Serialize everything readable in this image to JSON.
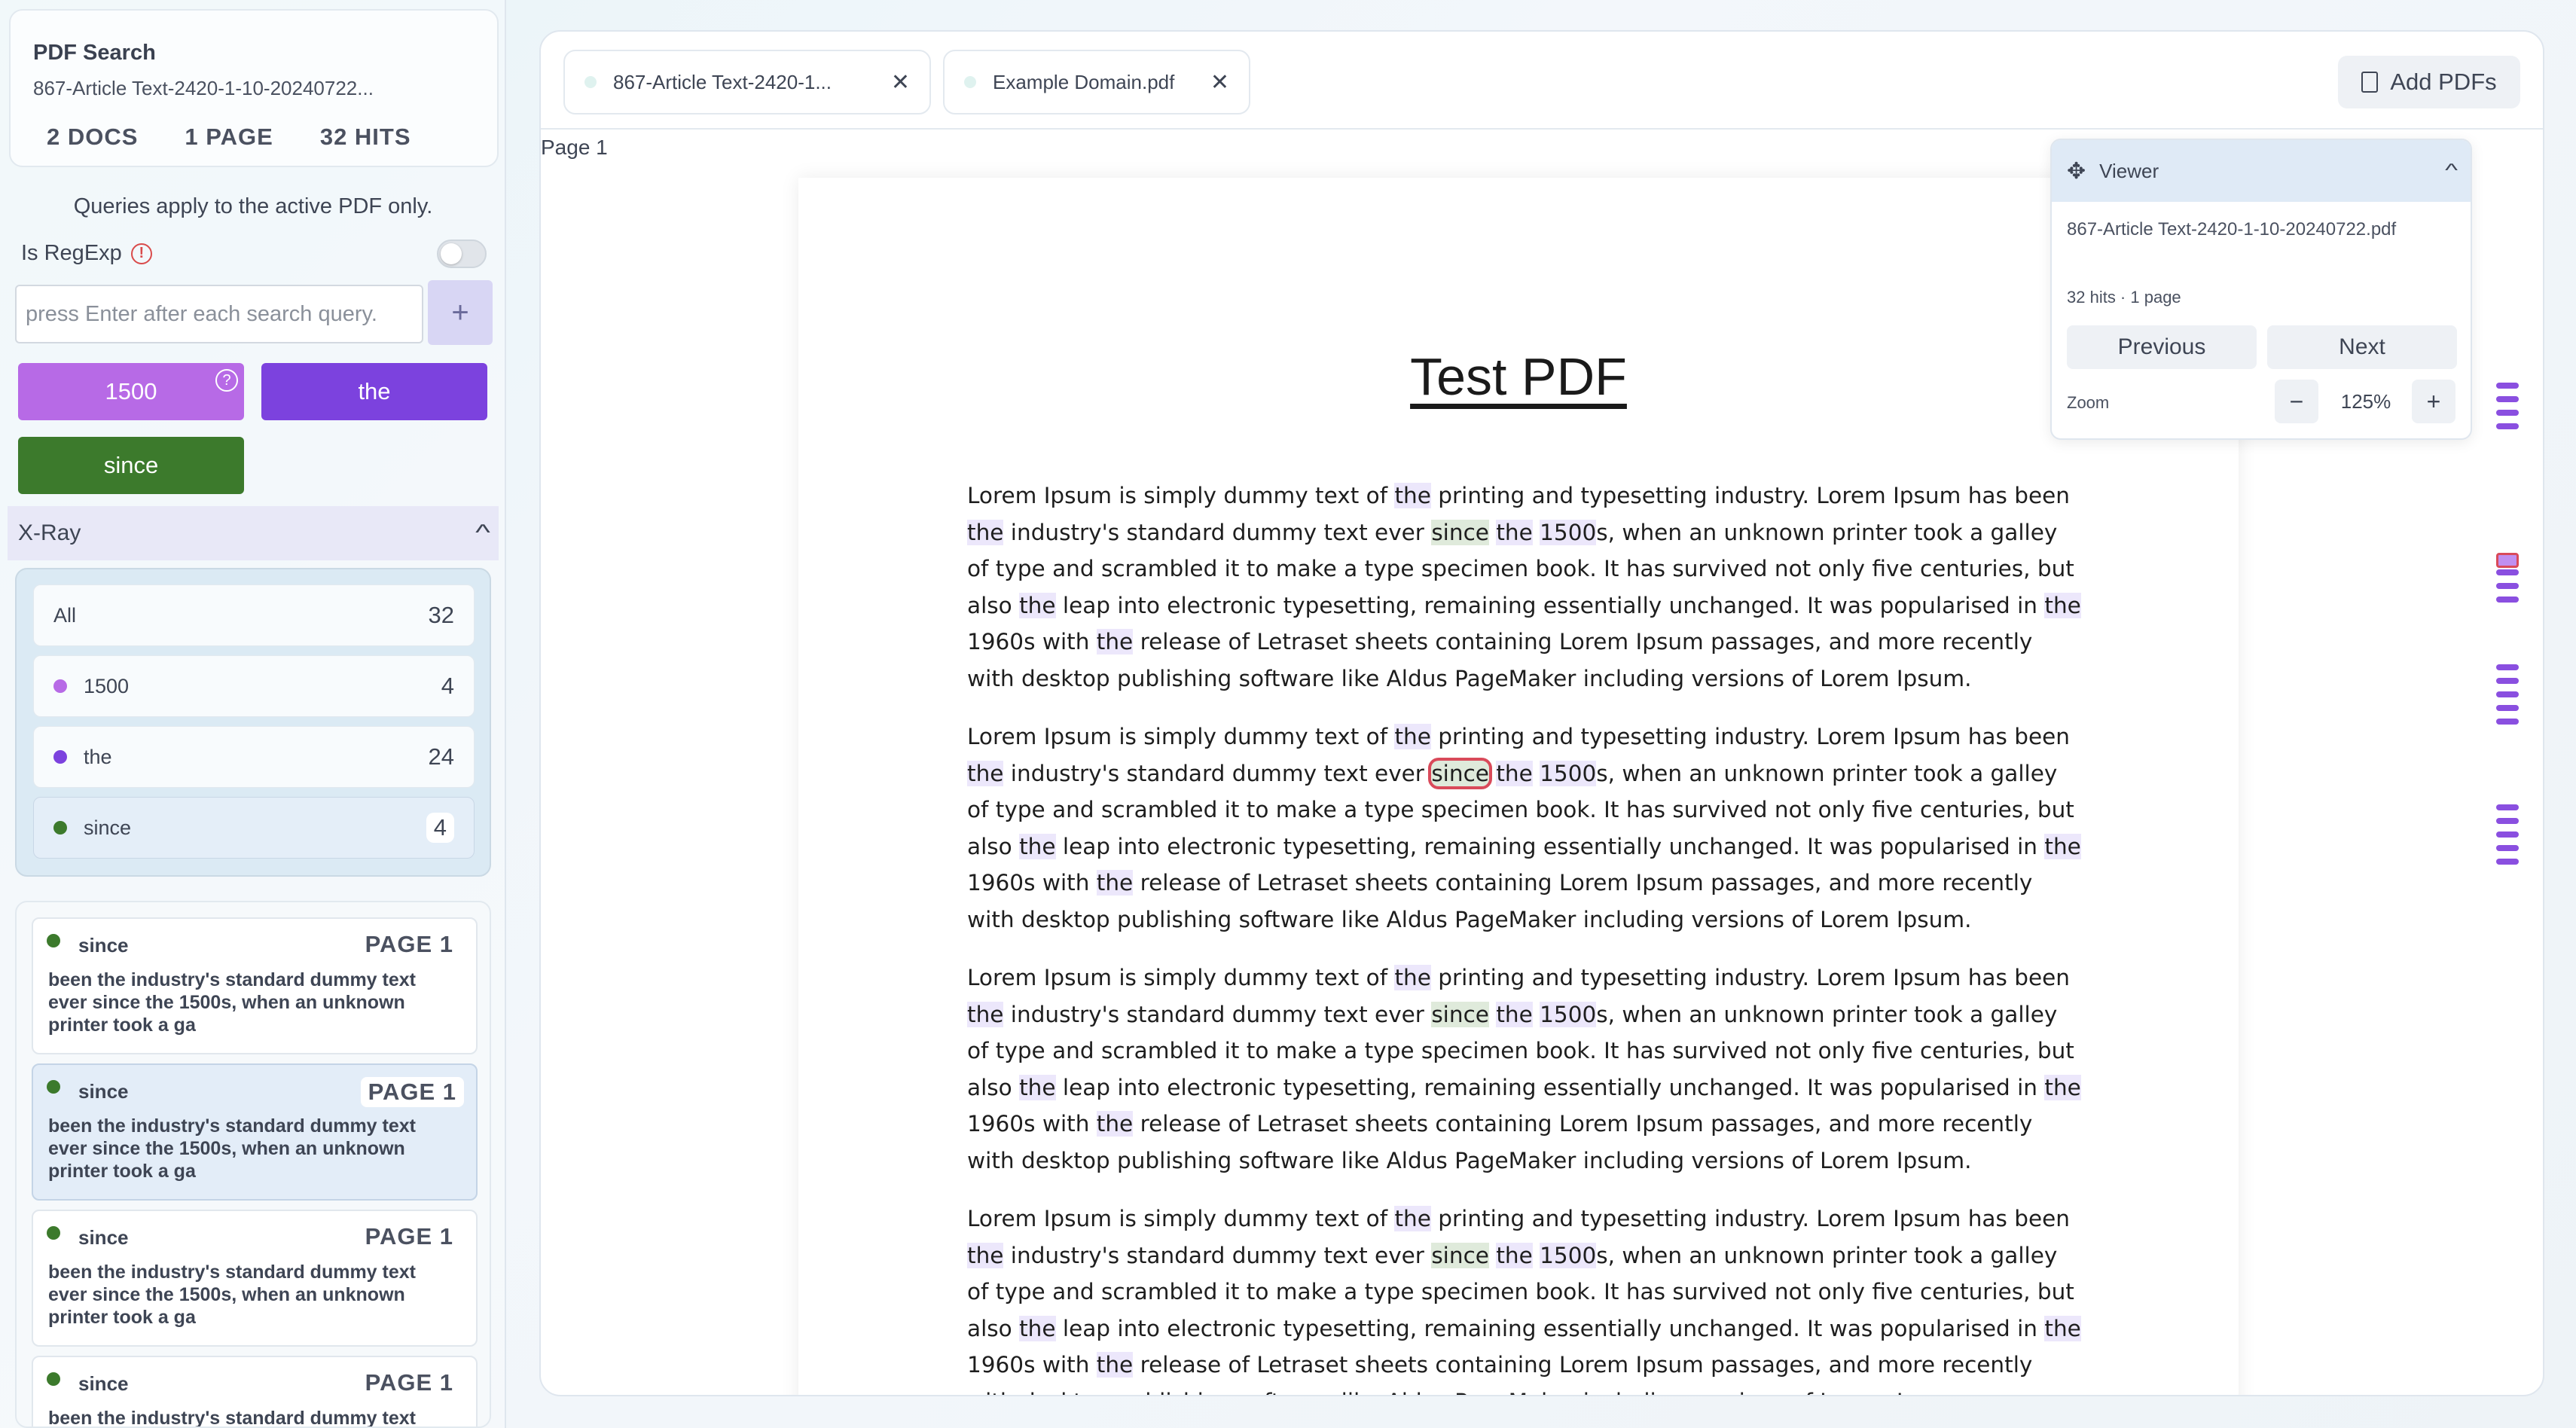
{
  "summary": {
    "title": "PDF Search",
    "file": "867-Article Text-2420-1-10-20240722...",
    "docs": "2 DOCS",
    "pages": "1 PAGE",
    "hits": "32 HITS"
  },
  "search": {
    "note": "Queries apply to the active PDF only.",
    "regexp_label": "Is RegExp",
    "regexp_enabled": false,
    "placeholder": "press Enter after each search query.",
    "add_label": "+"
  },
  "queries": [
    {
      "label": "1500",
      "color": "#b76ae6",
      "help": "?"
    },
    {
      "label": "the",
      "color": "#7c42de"
    },
    {
      "label": "since",
      "color": "#3c7a2c"
    }
  ],
  "xray": {
    "title": "X-Ray",
    "rows": [
      {
        "label": "All",
        "count": "32"
      },
      {
        "label": "1500",
        "count": "4",
        "color": "#b76ae6"
      },
      {
        "label": "the",
        "count": "24",
        "color": "#7c42de"
      },
      {
        "label": "since",
        "count": "4",
        "color": "#3c7a2c"
      }
    ]
  },
  "results": [
    {
      "term": "since",
      "page": "PAGE 1",
      "snippet": "been the industry's standard dummy text ever since the 1500s, when an unknown printer took a ga"
    },
    {
      "term": "since",
      "page": "PAGE 1",
      "snippet": "been the industry's standard dummy text ever since the 1500s, when an unknown printer took a ga"
    },
    {
      "term": "since",
      "page": "PAGE 1",
      "snippet": "been the industry's standard dummy text ever since the 1500s, when an unknown printer took a ga"
    },
    {
      "term": "since",
      "page": "PAGE 1",
      "snippet": "been the industry's standard dummy text"
    }
  ],
  "tabs": [
    {
      "label": "867-Article Text-2420-1...",
      "close": "✕"
    },
    {
      "label": "Example Domain.pdf",
      "close": "✕"
    }
  ],
  "add_pdfs_label": "Add PDFs",
  "page_label": "Page 1",
  "pdf": {
    "title": "Test PDF",
    "paragraph": "Lorem Ipsum is simply dummy text of the printing and typesetting industry. Lorem Ipsum has been the industry's standard dummy text ever since the 1500s, when an unknown printer took a galley of type and scrambled it to make a type specimen book. It has survived not only five centuries, but also the leap into electronic typesetting, remaining essentially unchanged. It was popularised in the 1960s with the release of Letraset sheets containing Lorem Ipsum passages, and more recently with desktop publishing software like Aldus PageMaker including versions of Lorem Ipsum."
  },
  "viewer": {
    "title": "Viewer",
    "file": "867-Article Text-2420-1-10-20240722.pdf",
    "meta": "32 hits · 1 page",
    "previous": "Previous",
    "next": "Next",
    "zoom_label": "Zoom",
    "zoom_value": "125%",
    "zoom_minus": "−",
    "zoom_plus": "+"
  },
  "colors": {
    "accent": "#7c42de",
    "highlight_the": "#ece7fb",
    "highlight_since": "#dfeadb",
    "current_match": "#d94a5a"
  }
}
